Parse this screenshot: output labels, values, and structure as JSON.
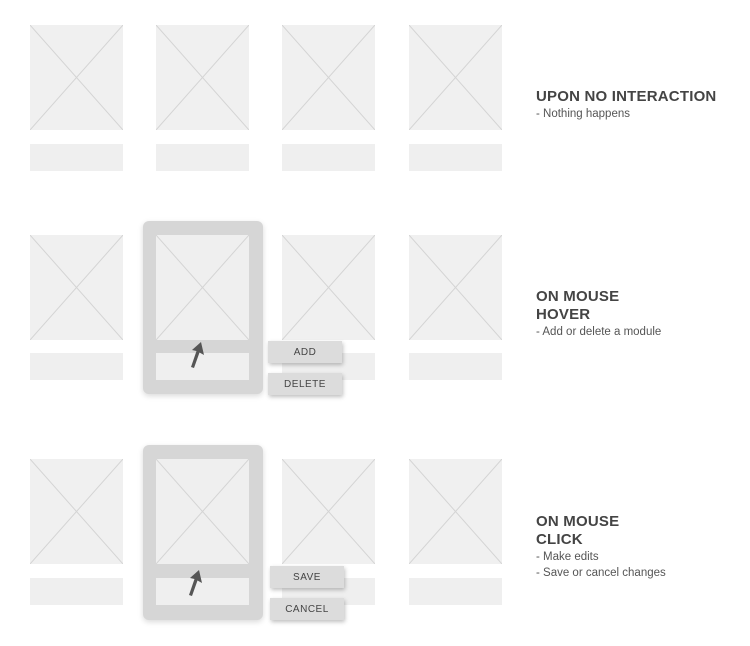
{
  "states": [
    {
      "title_lines": [
        "UPON NO INTERACTION"
      ],
      "description_lines": [
        "- Nothing happens"
      ]
    },
    {
      "title_lines": [
        "ON MOUSE",
        "HOVER"
      ],
      "description_lines": [
        "- Add or delete a module"
      ],
      "buttons": [
        "ADD",
        "DELETE"
      ]
    },
    {
      "title_lines": [
        "ON MOUSE",
        "CLICK"
      ],
      "description_lines": [
        "- Make edits",
        "- Save or cancel changes"
      ],
      "buttons": [
        "SAVE",
        "CANCEL"
      ]
    }
  ],
  "colors": {
    "placeholder": "#f0f0f0",
    "placeholder_lines": "#d4d4d4",
    "card": "#d6d6d6",
    "text": "#444444"
  },
  "icons": [
    "image-placeholder-icon",
    "mouse-cursor-icon"
  ]
}
